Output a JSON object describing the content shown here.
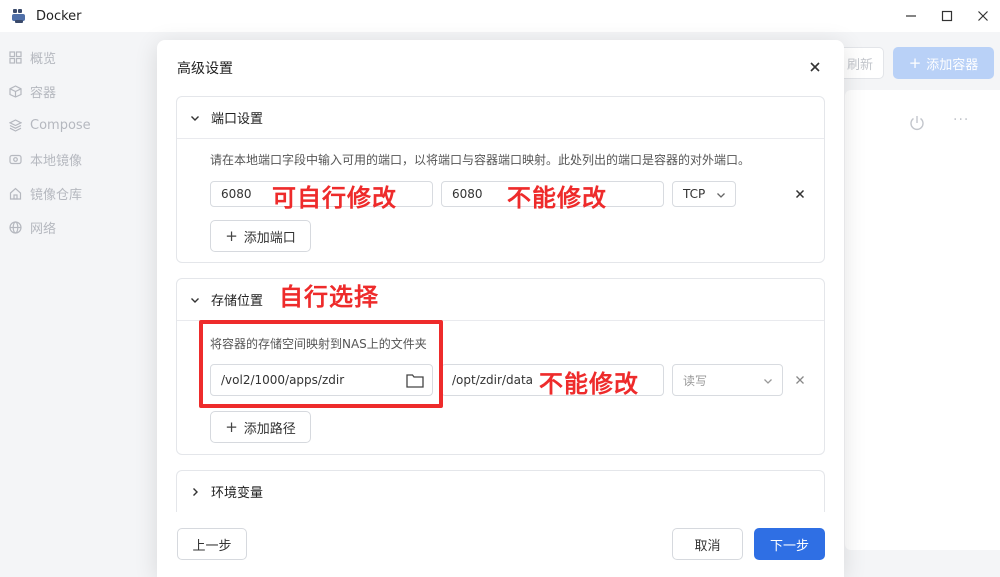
{
  "window": {
    "title": "Docker",
    "controls": [
      "minimize",
      "maximize",
      "close"
    ]
  },
  "sidebar": {
    "items": [
      {
        "label": "概览",
        "icon": "grid-icon"
      },
      {
        "label": "容器",
        "icon": "cube-icon"
      },
      {
        "label": "Compose",
        "icon": "layers-icon"
      },
      {
        "label": "本地镜像",
        "icon": "disc-icon"
      },
      {
        "label": "镜像仓库",
        "icon": "home-icon"
      },
      {
        "label": "网络",
        "icon": "globe-icon"
      }
    ]
  },
  "background": {
    "refresh_label": "刷新",
    "add_container_label": "添加容器"
  },
  "modal": {
    "title": "高级设置",
    "ports": {
      "heading": "端口设置",
      "hint": "请在本地端口字段中输入可用的端口，以将端口与容器端口映射。此处列出的端口是容器的对外端口。",
      "rows": [
        {
          "local_port": "6080",
          "container_port": "6080",
          "protocol": "TCP"
        }
      ],
      "add_label": "添加端口"
    },
    "storage": {
      "heading": "存储位置",
      "hint": "将容器的存储空间映射到NAS上的文件夹",
      "rows": [
        {
          "nas_path": "/vol2/1000/apps/zdir",
          "container_path": "/opt/zdir/data",
          "permission": "读写"
        }
      ],
      "add_label": "添加路径"
    },
    "env": {
      "heading": "环境变量"
    },
    "footer": {
      "prev_label": "上一步",
      "cancel_label": "取消",
      "next_label": "下一步"
    }
  },
  "annotations": {
    "editable_port": "可自行修改",
    "fixed_port": "不能修改",
    "choose_path": "自行选择",
    "fixed_path": "不能修改"
  },
  "colors": {
    "primary": "#2f6fe4",
    "primary_disabled": "#b9d1f7",
    "annotation": "#ee2b2b"
  }
}
